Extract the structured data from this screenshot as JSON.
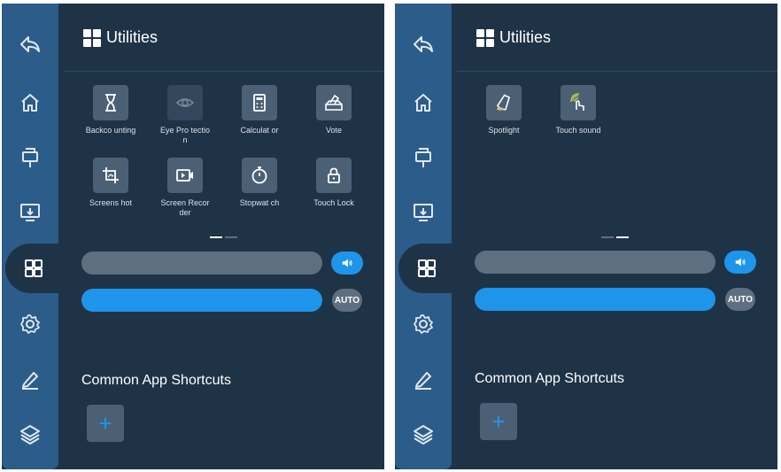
{
  "left": {
    "title": "Utilities",
    "tools": [
      {
        "label": "Backco unting",
        "icon": "hourglass-icon"
      },
      {
        "label": "Eye Pro tection",
        "icon": "eye-icon"
      },
      {
        "label": "Calculat or",
        "icon": "calculator-icon"
      },
      {
        "label": "Vote",
        "icon": "vote-icon"
      },
      {
        "label": "Screens hot",
        "icon": "screenshot-icon"
      },
      {
        "label": "Screen Recorder",
        "icon": "screen-recorder-icon"
      },
      {
        "label": "Stopwat ch",
        "icon": "stopwatch-icon"
      },
      {
        "label": "Touch Lock",
        "icon": "lock-icon"
      }
    ],
    "auto_label": "AUTO",
    "shortcuts_title": "Common App Shortcuts",
    "add_label": "+"
  },
  "right": {
    "title": "Utilities",
    "tools": [
      {
        "label": "Spotlight",
        "icon": "spotlight-icon"
      },
      {
        "label": "Touch sound",
        "icon": "touch-sound-icon"
      }
    ],
    "auto_label": "AUTO",
    "shortcuts_title": "Common App Shortcuts",
    "add_label": "+"
  },
  "sidebar_icons": [
    "back-icon",
    "home-icon",
    "input-source-icon",
    "screen-share-icon",
    "apps-grid-icon",
    "settings-gear-icon",
    "pen-icon",
    "layers-icon"
  ],
  "colors": {
    "panel_bg": "#1f3347",
    "sidebar": "#2c5c8a",
    "accent": "#1e95ea",
    "tile": "#4b6075"
  }
}
